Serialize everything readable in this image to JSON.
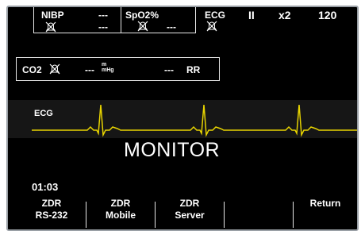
{
  "top_bar": {
    "nibp": {
      "label": "NIBP",
      "value_top": "---",
      "value_bottom": "---"
    },
    "spo2": {
      "label": "SpO2%",
      "value": "---"
    },
    "ecg": {
      "label": "ECG",
      "lead": "II",
      "gain": "x2",
      "rate": "120"
    }
  },
  "co2_box": {
    "label": "CO2",
    "value": "---",
    "unit_top": "m",
    "unit_bottom": "mHg",
    "rr_value": "---",
    "rr_label": "RR"
  },
  "ecg_trace": {
    "label": "ECG",
    "color": "#e8d400"
  },
  "mode_label": "MONITOR",
  "timer": "01:03",
  "menu": [
    {
      "line1": "ZDR",
      "line2": "RS-232"
    },
    {
      "line1": "ZDR",
      "line2": "Mobile"
    },
    {
      "line1": "ZDR",
      "line2": "Server"
    },
    {
      "line1": "",
      "line2": ""
    },
    {
      "line1": "",
      "line2": "Return"
    }
  ],
  "icons": {
    "alarm": "alarm-off-icon"
  }
}
